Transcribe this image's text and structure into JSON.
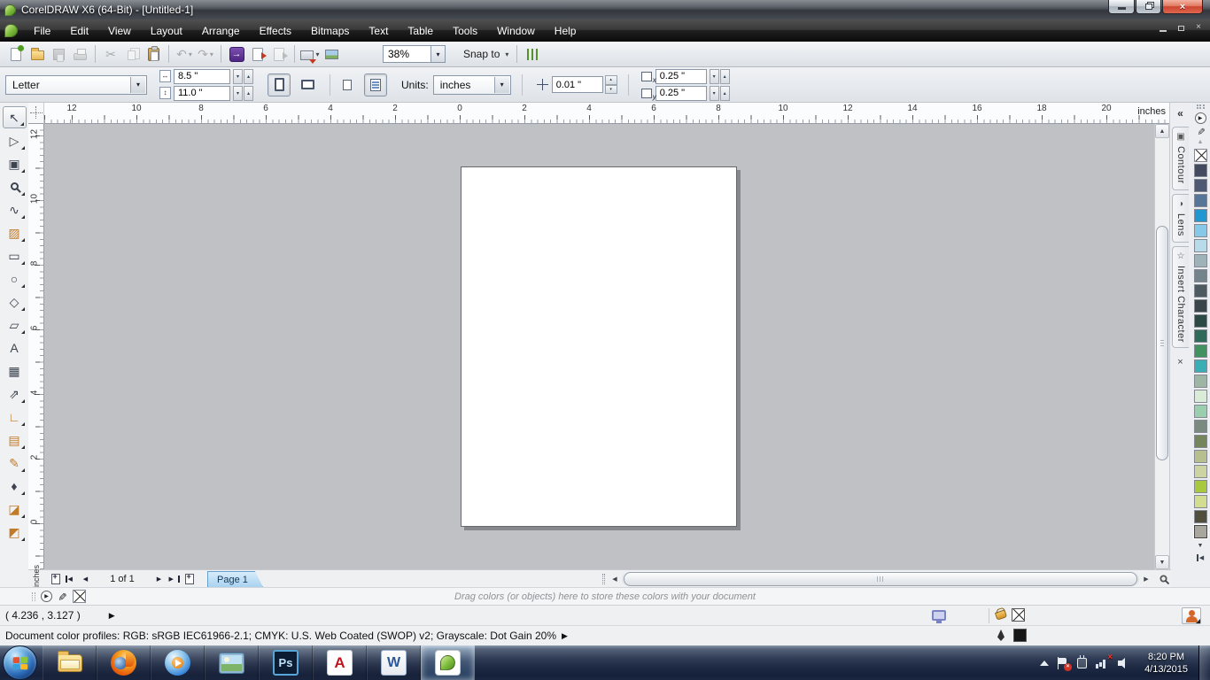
{
  "window": {
    "title": "CorelDRAW X6 (64-Bit) - [Untitled-1]"
  },
  "glyphs": {
    "dropdown": "▾",
    "spin_up": "▴",
    "spin_down": "▾",
    "arrow_left": "◀",
    "arrow_right": "▶",
    "arrow_up": "▲",
    "arrow_down": "▼",
    "collapse": "«",
    "close": "×",
    "plus": "+",
    "width_arrow": "↔",
    "height_arrow": "↕",
    "eyedropper": "✎"
  },
  "menu": {
    "items": [
      "File",
      "Edit",
      "View",
      "Layout",
      "Arrange",
      "Effects",
      "Bitmaps",
      "Text",
      "Table",
      "Tools",
      "Window",
      "Help"
    ]
  },
  "toolbar": {
    "zoom_level": "38%",
    "snap_label": "Snap to",
    "buttons": [
      {
        "name": "new-document",
        "type": "doc",
        "accent": "#4e9c22",
        "enabled": true
      },
      {
        "name": "open",
        "type": "folder",
        "enabled": true
      },
      {
        "name": "save",
        "type": "disk",
        "enabled": false
      },
      {
        "name": "print",
        "type": "printer",
        "enabled": false
      },
      {
        "type": "sep"
      },
      {
        "name": "cut",
        "glyph": "✂",
        "enabled": false
      },
      {
        "name": "copy",
        "type": "copy",
        "enabled": false
      },
      {
        "name": "paste",
        "type": "paste",
        "enabled": true
      },
      {
        "type": "sep"
      },
      {
        "name": "undo",
        "glyph": "↶",
        "enabled": false,
        "dropdown": true
      },
      {
        "name": "redo",
        "glyph": "↷",
        "enabled": false,
        "dropdown": true
      },
      {
        "type": "sep"
      },
      {
        "name": "search-content",
        "type": "search",
        "glyph": "→",
        "enabled": true
      },
      {
        "name": "import",
        "type": "import",
        "enabled": true
      },
      {
        "name": "export",
        "type": "export",
        "enabled": false
      },
      {
        "type": "sep"
      },
      {
        "name": "application-launcher",
        "type": "launcher",
        "enabled": true,
        "dropdown": true
      },
      {
        "name": "welcome-screen",
        "type": "welcome",
        "enabled": true
      }
    ]
  },
  "property_bar": {
    "paper_type": "Letter",
    "page_width": "8.5 \"",
    "page_height": "11.0 \"",
    "units_label": "Units:",
    "units": "inches",
    "nudge": "0.01 \"",
    "duplicate_x": "0.25 \"",
    "duplicate_y": "0.25 \"",
    "dup_x_sub": "x",
    "dup_y_sub": "y"
  },
  "rulers": {
    "horizontal": [
      "12",
      "10",
      "8",
      "6",
      "4",
      "2",
      "0",
      "2",
      "4",
      "6",
      "8",
      "10",
      "12",
      "14",
      "16",
      "18",
      "20"
    ],
    "vertical": [
      "12",
      "10",
      "8",
      "6",
      "4",
      "2",
      "0"
    ],
    "unit_label": "inches"
  },
  "toolbox": {
    "tools": [
      {
        "name": "pick-tool",
        "glyph": "↖",
        "selected": true,
        "flyout": true
      },
      {
        "name": "shape-tool",
        "glyph": "▷",
        "flyout": true
      },
      {
        "name": "crop-tool",
        "glyph": "▣",
        "flyout": true
      },
      {
        "name": "zoom-tool",
        "icon": "mag",
        "flyout": true
      },
      {
        "name": "freehand-tool",
        "glyph": "∿",
        "flyout": true
      },
      {
        "name": "smart-fill-tool",
        "glyph": "▨",
        "flyout": true,
        "color": "#c07a28"
      },
      {
        "name": "rectangle-tool",
        "glyph": "▭",
        "flyout": true
      },
      {
        "name": "ellipse-tool",
        "glyph": "○",
        "flyout": true
      },
      {
        "name": "polygon-tool",
        "glyph": "◇",
        "flyout": true
      },
      {
        "name": "basic-shapes-tool",
        "glyph": "▱",
        "flyout": true
      },
      {
        "name": "text-tool",
        "glyph": "A",
        "flyout": false
      },
      {
        "name": "table-tool",
        "glyph": "▦",
        "flyout": false
      },
      {
        "name": "parallel-dimension-tool",
        "glyph": "⇗",
        "flyout": true
      },
      {
        "name": "straight-line-connector-tool",
        "glyph": "∟",
        "flyout": true,
        "color": "#c07a28"
      },
      {
        "name": "drop-shadow-tool",
        "glyph": "▤",
        "flyout": true,
        "color": "#c07a28"
      },
      {
        "name": "color-eyedropper-tool",
        "glyph": "✎",
        "flyout": true,
        "color": "#c07a28"
      },
      {
        "name": "outline-pen-tool",
        "glyph": "♦",
        "flyout": true
      },
      {
        "name": "fill-tool",
        "glyph": "◪",
        "flyout": true,
        "color": "#c07a28"
      },
      {
        "name": "interactive-fill-tool",
        "glyph": "◩",
        "flyout": true,
        "color": "#c07a28"
      }
    ]
  },
  "dockers": {
    "tabs": [
      {
        "name": "docker-tab-contour",
        "label": "Contour",
        "icon": "▣"
      },
      {
        "name": "docker-tab-lens",
        "label": "Lens",
        "icon": "◑"
      },
      {
        "name": "docker-tab-insert-character",
        "label": "Insert Character",
        "icon": "☆"
      }
    ]
  },
  "palette": {
    "colors": [
      "none",
      "#444b60",
      "#4e5a74",
      "#567699",
      "#2097d1",
      "#86c8e8",
      "#b7dbe8",
      "#9eb3b8",
      "#73848a",
      "#4d5a60",
      "#394549",
      "#2c4a44",
      "#2f6a58",
      "#41925f",
      "#3aaeb5",
      "#9db5a3",
      "#d8ecd8",
      "#99cfae",
      "#7b8a7e",
      "#76865c",
      "#b8bf8e",
      "#ced3a2",
      "#a8c93e",
      "#d3dd90",
      "#514e3c",
      "#a9a69d"
    ]
  },
  "page_nav": {
    "counter": "1 of 1",
    "tab_label": "Page 1"
  },
  "document_palette": {
    "hint": "Drag colors (or objects) here to store these colors with your document"
  },
  "status": {
    "coords": "( 4.236 , 3.127 )",
    "profiles": "Document color profiles: RGB: sRGB IEC61966-2.1; CMYK: U.S. Web Coated (SWOP) v2; Grayscale: Dot Gain 20%"
  },
  "taskbar": {
    "clock": {
      "time": "8:20 PM",
      "date": "4/13/2015"
    },
    "apps": [
      {
        "name": "windows-explorer"
      },
      {
        "name": "firefox"
      },
      {
        "name": "windows-media-player"
      },
      {
        "name": "photo-viewer"
      },
      {
        "name": "photoshop",
        "icon_text": "Ps"
      },
      {
        "name": "adobe-reader",
        "icon_text": "A"
      },
      {
        "name": "word",
        "icon_text": "W"
      },
      {
        "name": "coreldraw",
        "active": true
      }
    ]
  }
}
